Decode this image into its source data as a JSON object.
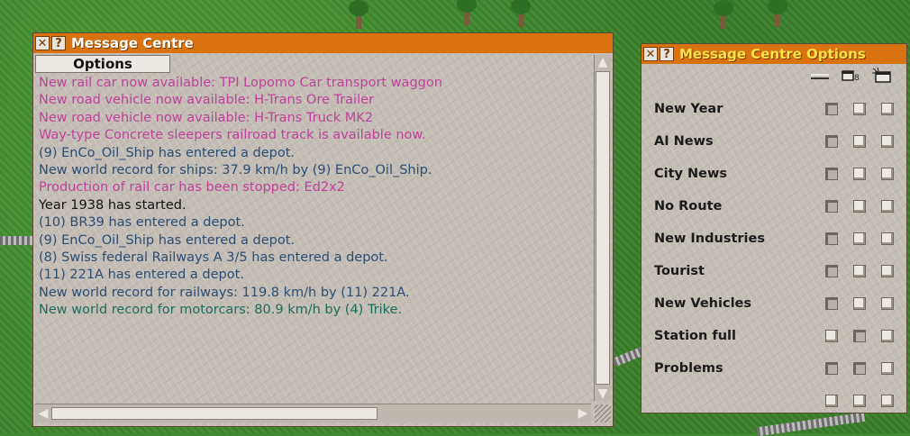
{
  "message_centre": {
    "title": "Message Centre",
    "close_icon": "close-icon",
    "help_icon": "help-icon",
    "options_tab": "Options",
    "messages": [
      {
        "text": "New rail car now available: TPI Lopomo Car transport waggon",
        "color": "#c0409a"
      },
      {
        "text": "New road vehicle now available: H-Trans Ore Trailer",
        "color": "#c0409a"
      },
      {
        "text": "New road vehicle now available: H-Trans Truck MK2",
        "color": "#c0409a"
      },
      {
        "text": "Way-type Concrete sleepers railroad track is available now.",
        "color": "#c0409a"
      },
      {
        "text": "(9) EnCo_Oil_Ship has entered a depot.",
        "color": "#2b4d73"
      },
      {
        "text": "New world record for ships:  37.9 km/h by (9) EnCo_Oil_Ship.",
        "color": "#2b4d73"
      },
      {
        "text": "Production of rail car has been stopped: Ed2x2",
        "color": "#c0409a"
      },
      {
        "text": "Year 1938 has started.",
        "color": "#111111"
      },
      {
        "text": "(10) BR39 has entered a depot.",
        "color": "#2b4d73"
      },
      {
        "text": "(9) EnCo_Oil_Ship has entered a depot.",
        "color": "#2b4d73"
      },
      {
        "text": "(8) Swiss federal Railways A 3/5 has entered a depot.",
        "color": "#2b4d73"
      },
      {
        "text": "(11) 221A has entered a depot.",
        "color": "#2b4d73"
      },
      {
        "text": "New world record for  railways:  119.8 km/h  by (11) 221A.",
        "color": "#2b4d73"
      },
      {
        "text": "New world record for motorcars:  80.9 km/h by (4) Trike.",
        "color": "#1e6b5a"
      }
    ]
  },
  "options_window": {
    "title": "Message Centre Options",
    "close_icon": "close-icon",
    "help_icon": "help-icon",
    "column_icons": [
      "ticker-icon",
      "window-icon",
      "autoclose-window-icon"
    ],
    "rows": [
      {
        "label": "New Year",
        "checks": [
          false,
          true,
          true
        ]
      },
      {
        "label": "AI News",
        "checks": [
          false,
          true,
          true
        ]
      },
      {
        "label": "City News",
        "checks": [
          false,
          true,
          true
        ]
      },
      {
        "label": "No Route",
        "checks": [
          false,
          true,
          true
        ]
      },
      {
        "label": "New Industries",
        "checks": [
          false,
          true,
          true
        ]
      },
      {
        "label": "Tourist",
        "checks": [
          false,
          true,
          true
        ]
      },
      {
        "label": "New Vehicles",
        "checks": [
          false,
          true,
          true
        ]
      },
      {
        "label": "Station full",
        "checks": [
          true,
          false,
          true
        ]
      },
      {
        "label": "Problems",
        "checks": [
          false,
          false,
          true
        ]
      },
      {
        "label": "",
        "checks": [
          true,
          true,
          true
        ]
      }
    ]
  }
}
